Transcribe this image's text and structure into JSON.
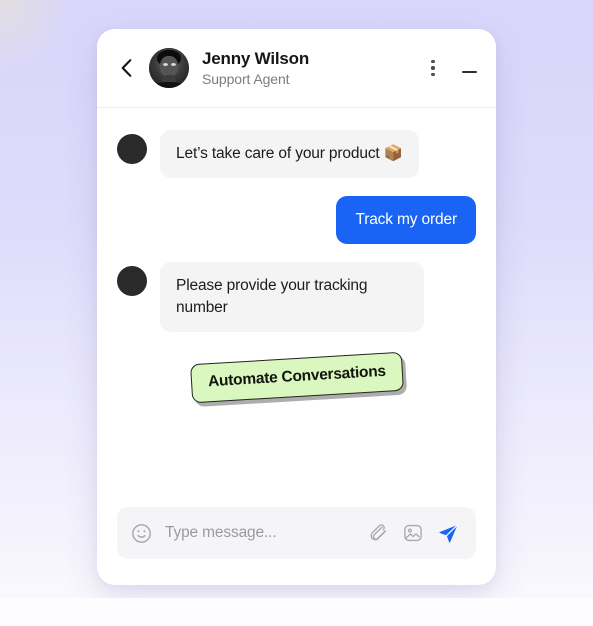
{
  "header": {
    "back_icon": "chevron-left-icon",
    "avatar_alt": "agent-avatar",
    "agent_name": "Jenny Wilson",
    "agent_role": "Support Agent",
    "menu_icon": "kebab-menu-icon",
    "minimize_icon": "minimize-icon"
  },
  "messages": [
    {
      "id": "msg-1",
      "direction": "in",
      "text": "Let’s take care of your product 📦"
    },
    {
      "id": "msg-2",
      "direction": "out",
      "text": "Track my order"
    },
    {
      "id": "msg-3",
      "direction": "in",
      "text": "Please provide your tracking number"
    }
  ],
  "sticker": {
    "label": "Automate Conversations"
  },
  "composer": {
    "emoji_icon": "smiley-icon",
    "placeholder": "Type message...",
    "value": "",
    "attach_icon": "paperclip-icon",
    "image_icon": "image-icon",
    "send_icon": "send-icon"
  },
  "colors": {
    "accent_blue": "#1964f5",
    "sticker_green": "#d9f7bf",
    "bubble_gray": "#f4f4f5",
    "page_top": "#d9d5fb",
    "page_bottom": "#fbfbfe"
  }
}
